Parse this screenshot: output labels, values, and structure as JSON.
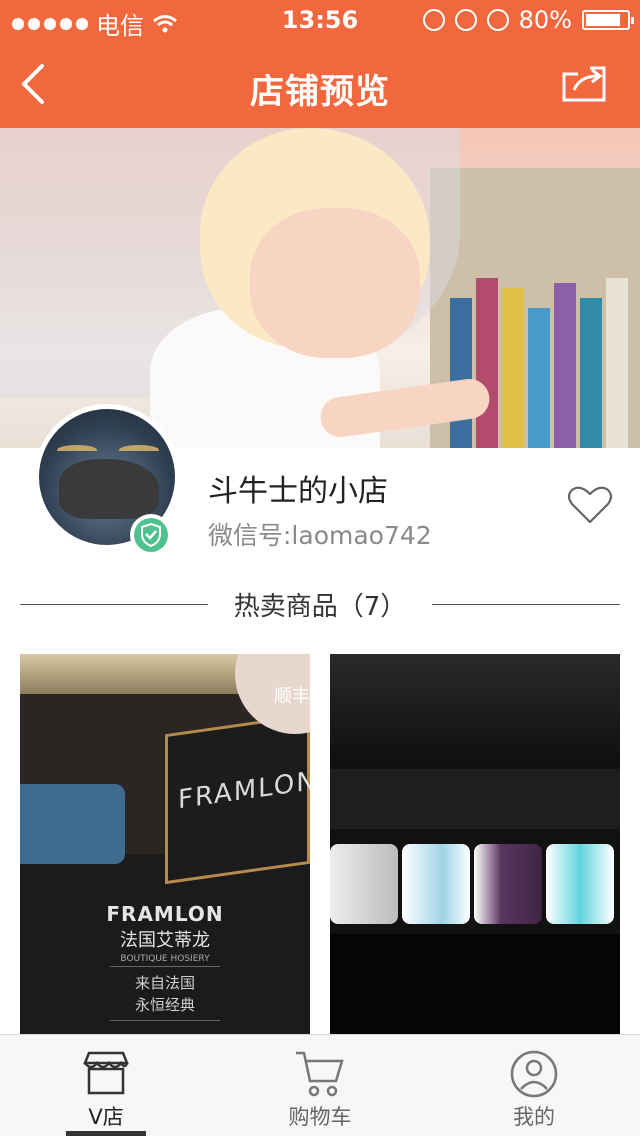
{
  "status_bar": {
    "carrier": "电信",
    "time": "13:56",
    "battery": "80%",
    "battery_level": 0.8
  },
  "nav": {
    "title": "店铺预览",
    "back_icon": "chevron-left-icon",
    "share_icon": "share-icon"
  },
  "colors": {
    "accent": "#f2683e",
    "verified": "#4ec18e"
  },
  "shop": {
    "name": "斗牛士的小店",
    "wechat": "微信号:laomao742",
    "favorite_icon": "heart-outline-icon"
  },
  "section": {
    "title": "热卖商品（7）"
  },
  "products": [
    {
      "brand_en": "FRAMLON",
      "brand_cn": "法国艾蒂龙",
      "brand_sub": "BOUTIQUE HOSIERY",
      "tagline_1": "来自法国",
      "tagline_2": "永恒经典",
      "corner_text": "顺丰"
    },
    {
      "image": "socks-gift-box"
    }
  ],
  "tabbar": {
    "items": [
      {
        "label": "V店",
        "icon": "store-icon",
        "active": true
      },
      {
        "label": "购物车",
        "icon": "cart-icon",
        "active": false
      },
      {
        "label": "我的",
        "icon": "user-icon",
        "active": false
      }
    ]
  }
}
